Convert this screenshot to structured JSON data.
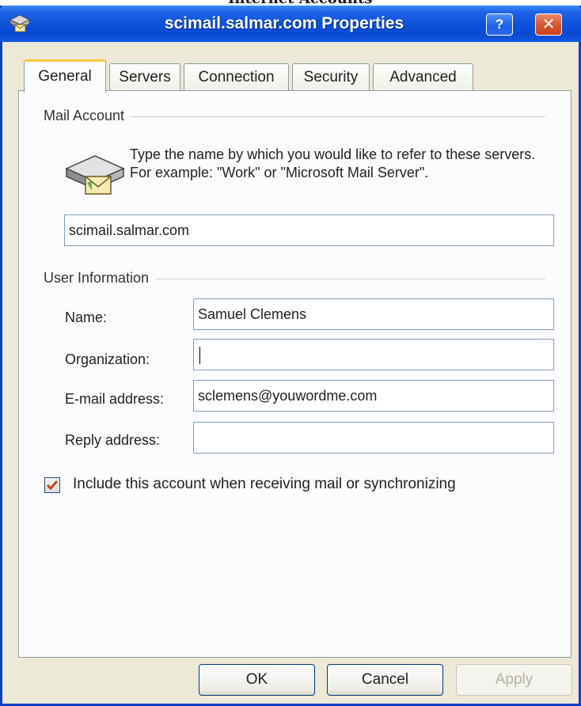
{
  "background_window_title": "Internet Accounts",
  "title_bar": {
    "title": "scimail.salmar.com Properties",
    "help_label": "?",
    "close_label": "✕"
  },
  "tabs": [
    {
      "label": "General",
      "active": true
    },
    {
      "label": "Servers",
      "active": false
    },
    {
      "label": "Connection",
      "active": false
    },
    {
      "label": "Security",
      "active": false
    },
    {
      "label": "Advanced",
      "active": false
    }
  ],
  "mail_account": {
    "group_label": "Mail Account",
    "description": "Type the name by which you would like to refer to these servers.  For example: \"Work\" or \"Microsoft Mail Server\".",
    "account_name_value": "scimail.salmar.com"
  },
  "user_information": {
    "group_label": "User Information",
    "name_label": "Name:",
    "name_value": "Samuel Clemens",
    "organization_label": "Organization:",
    "organization_value": "",
    "email_label": "E-mail address:",
    "email_value": "sclemens@youwordme.com",
    "reply_label": "Reply address:",
    "reply_value": ""
  },
  "include_account": {
    "label": "Include this account when receiving mail or synchronizing",
    "checked": true
  },
  "buttons": {
    "ok": "OK",
    "cancel": "Cancel",
    "apply": "Apply"
  },
  "colors": {
    "title_bar": "#0a4ad2",
    "dialog_face": "#ece9d8",
    "tab_highlight": "#ffc83c",
    "check_mark": "#c8421a"
  }
}
